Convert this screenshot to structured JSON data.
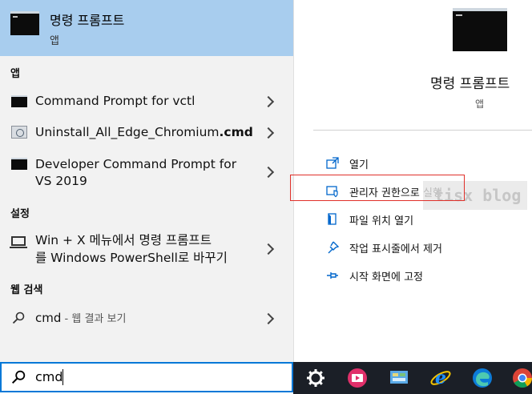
{
  "best_match": {
    "title": "명령 프롬프트",
    "subtitle": "앱",
    "icon": "command-prompt-icon"
  },
  "sections": {
    "apps": "앱",
    "settings": "설정",
    "web": "웹 검색"
  },
  "apps": [
    {
      "label": "Command Prompt for vctl",
      "icon": "command-prompt-icon"
    },
    {
      "label_prefix": "Uninstall_All_Edge_Chromium",
      "label_bold": ".cmd",
      "icon": "script-file-icon"
    },
    {
      "label_line1": "Developer Command Prompt for",
      "label_line2": "VS 2019",
      "icon": "command-prompt-icon"
    }
  ],
  "setting_item": {
    "line1": "Win + X 메뉴에서 명령 프롬프트",
    "line2": "를 Windows PowerShell로 바꾸기",
    "icon": "settings-monitor-icon"
  },
  "web_item": {
    "query": "cmd",
    "suffix": " - 웹 결과 보기",
    "icon": "search-icon"
  },
  "search": {
    "value": "cmd",
    "icon": "search-icon"
  },
  "detail": {
    "title": "명령 프롬프트",
    "subtitle": "앱",
    "actions": [
      {
        "label": "열기",
        "icon": "open-icon"
      },
      {
        "label": "관리자 권한으로 실행",
        "icon": "admin-shield-icon"
      },
      {
        "label": "파일 위치 열기",
        "icon": "file-location-icon"
      },
      {
        "label": "작업 표시줄에서 제거",
        "icon": "unpin-taskbar-icon"
      },
      {
        "label": "시작 화면에 고정",
        "icon": "pin-start-icon"
      }
    ]
  },
  "watermark": "tisx blog",
  "taskbar": [
    "settings-gear-icon",
    "media-app-icon",
    "control-panel-icon",
    "internet-explorer-icon",
    "edge-icon",
    "chrome-icon"
  ],
  "colors": {
    "selection": "#a8cdee",
    "accent": "#0078d7",
    "highlight_border": "#e0302a",
    "taskbar": "#1b1f27"
  }
}
